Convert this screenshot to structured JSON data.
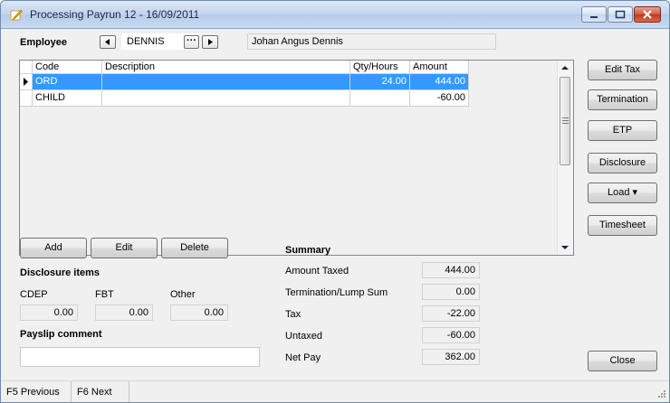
{
  "window": {
    "title": "Processing Payrun 12 - 16/09/2011"
  },
  "employee": {
    "label": "Employee",
    "code": "DENNIS",
    "name": "Johan Angus Dennis",
    "ellipsis": "···"
  },
  "grid": {
    "headers": {
      "code": "Code",
      "description": "Description",
      "qty": "Qty/Hours",
      "amount": "Amount"
    },
    "rows": [
      {
        "code": "ORD",
        "description": "",
        "qty": "24.00",
        "amount": "444.00",
        "selected": true
      },
      {
        "code": "CHILD",
        "description": "",
        "qty": "",
        "amount": "-60.00",
        "selected": false
      }
    ]
  },
  "right_buttons": {
    "edit_tax": "Edit Tax",
    "termination": "Termination",
    "etp": "ETP",
    "disclosure": "Disclosure",
    "load": "Load ▾",
    "timesheet": "Timesheet",
    "close": "Close"
  },
  "actions": {
    "add": "Add",
    "edit": "Edit",
    "delete": "Delete"
  },
  "disclosure": {
    "title": "Disclosure items",
    "cdep_label": "CDEP",
    "cdep_value": "0.00",
    "fbt_label": "FBT",
    "fbt_value": "0.00",
    "other_label": "Other",
    "other_value": "0.00"
  },
  "payslip": {
    "title": "Payslip comment",
    "value": ""
  },
  "summary": {
    "title": "Summary",
    "amount_taxed_label": "Amount Taxed",
    "amount_taxed": "444.00",
    "termination_label": "Termination/Lump Sum",
    "termination": "0.00",
    "tax_label": "Tax",
    "tax": "-22.00",
    "untaxed_label": "Untaxed",
    "untaxed": "-60.00",
    "net_pay_label": "Net Pay",
    "net_pay": "362.00"
  },
  "statusbar": {
    "prev": "F5 Previous",
    "next": "F6 Next"
  }
}
